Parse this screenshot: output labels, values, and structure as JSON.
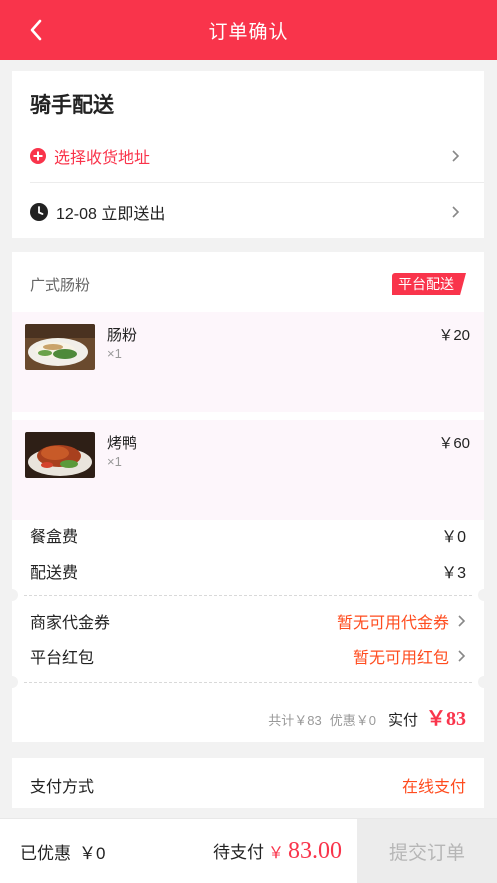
{
  "header": {
    "title": "订单确认",
    "back_icon": "chevron-left-icon"
  },
  "delivery": {
    "title": "骑手配送",
    "address_label": "选择收货地址",
    "time_label": "12-08 立即送出"
  },
  "order": {
    "shop_name": "广式肠粉",
    "badge": "平台配送",
    "items": [
      {
        "name": "肠粉",
        "qty": "×1",
        "price": "￥20"
      },
      {
        "name": "烤鸭",
        "qty": "×1",
        "price": "￥60"
      }
    ],
    "fees": [
      {
        "label": "餐盒费",
        "value": "￥0"
      },
      {
        "label": "配送费",
        "value": "￥3"
      }
    ],
    "coupons": [
      {
        "label": "商家代金券",
        "value": "暂无可用代金券"
      },
      {
        "label": "平台红包",
        "value": "暂无可用红包"
      }
    ],
    "total": {
      "total_text": "共计￥83",
      "discount_text": "优惠￥0",
      "paid_label": "实付",
      "paid_value": "￥83"
    }
  },
  "payment": {
    "label": "支付方式",
    "value": "在线支付"
  },
  "bottom": {
    "discount_label": "已优惠",
    "discount_value": "￥0",
    "topay_label": "待支付",
    "topay_currency": "￥",
    "topay_amount": "83.00",
    "submit_label": "提交订单"
  },
  "colors": {
    "brand": "#f9344b",
    "accent_orange": "#ff4c1f",
    "item_bg": "#fdf6fb"
  }
}
